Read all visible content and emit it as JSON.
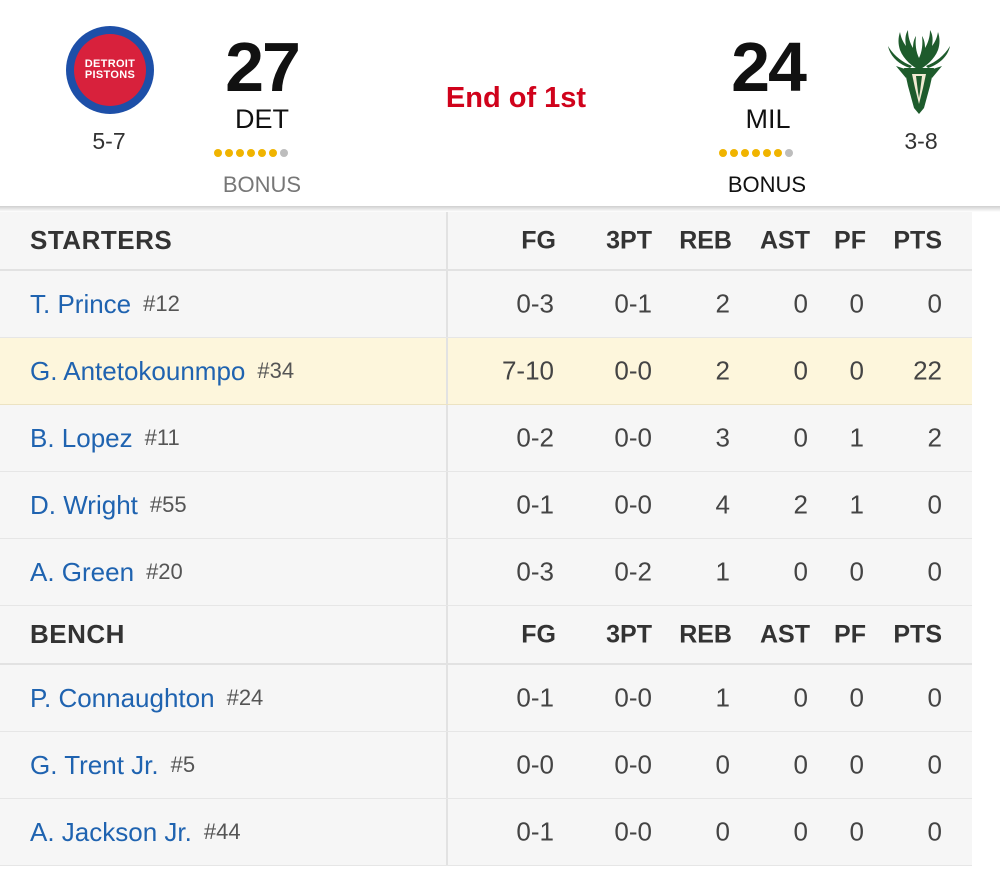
{
  "game": {
    "status": "End of 1st",
    "status_color": "#d0021b",
    "home": {
      "logo_text_line1": "DETROIT",
      "logo_text_line2": "PISTONS",
      "logo_colors": {
        "outer": "#1d4fa8",
        "inner": "#d8213c"
      },
      "record": "5-7",
      "score": "27",
      "abbr": "DET",
      "timeouts_remaining": 6,
      "timeouts_total": 7,
      "bonus_label": "BONUS"
    },
    "away": {
      "logo_icon": "bucks-deer-icon",
      "record": "3-8",
      "score": "24",
      "abbr": "MIL",
      "timeouts_remaining": 6,
      "timeouts_total": 7,
      "bonus_label": "BONUS"
    }
  },
  "columns": [
    "FG",
    "3PT",
    "REB",
    "AST",
    "PF",
    "PTS"
  ],
  "sections": [
    {
      "title": "STARTERS",
      "players": [
        {
          "name": "T. Prince",
          "jersey": "#12",
          "fg": "0-3",
          "tpt": "0-1",
          "reb": "2",
          "ast": "0",
          "pf": "0",
          "pts": "0",
          "highlight": false
        },
        {
          "name": "G. Antetokounmpo",
          "jersey": "#34",
          "fg": "7-10",
          "tpt": "0-0",
          "reb": "2",
          "ast": "0",
          "pf": "0",
          "pts": "22",
          "highlight": true
        },
        {
          "name": "B. Lopez",
          "jersey": "#11",
          "fg": "0-2",
          "tpt": "0-0",
          "reb": "3",
          "ast": "0",
          "pf": "1",
          "pts": "2",
          "highlight": false
        },
        {
          "name": "D. Wright",
          "jersey": "#55",
          "fg": "0-1",
          "tpt": "0-0",
          "reb": "4",
          "ast": "2",
          "pf": "1",
          "pts": "0",
          "highlight": false
        },
        {
          "name": "A. Green",
          "jersey": "#20",
          "fg": "0-3",
          "tpt": "0-2",
          "reb": "1",
          "ast": "0",
          "pf": "0",
          "pts": "0",
          "highlight": false
        }
      ]
    },
    {
      "title": "BENCH",
      "players": [
        {
          "name": "P. Connaughton",
          "jersey": "#24",
          "fg": "0-1",
          "tpt": "0-0",
          "reb": "1",
          "ast": "0",
          "pf": "0",
          "pts": "0",
          "highlight": false
        },
        {
          "name": "G. Trent Jr.",
          "jersey": "#5",
          "fg": "0-0",
          "tpt": "0-0",
          "reb": "0",
          "ast": "0",
          "pf": "0",
          "pts": "0",
          "highlight": false
        },
        {
          "name": "A. Jackson Jr.",
          "jersey": "#44",
          "fg": "0-1",
          "tpt": "0-0",
          "reb": "0",
          "ast": "0",
          "pf": "0",
          "pts": "0",
          "highlight": false
        }
      ]
    }
  ],
  "colors": {
    "player_link": "#1f63b0",
    "highlight_row": "#fdf6dc",
    "timeout_on": "#f0b400",
    "timeout_off": "#bdbdbd"
  }
}
